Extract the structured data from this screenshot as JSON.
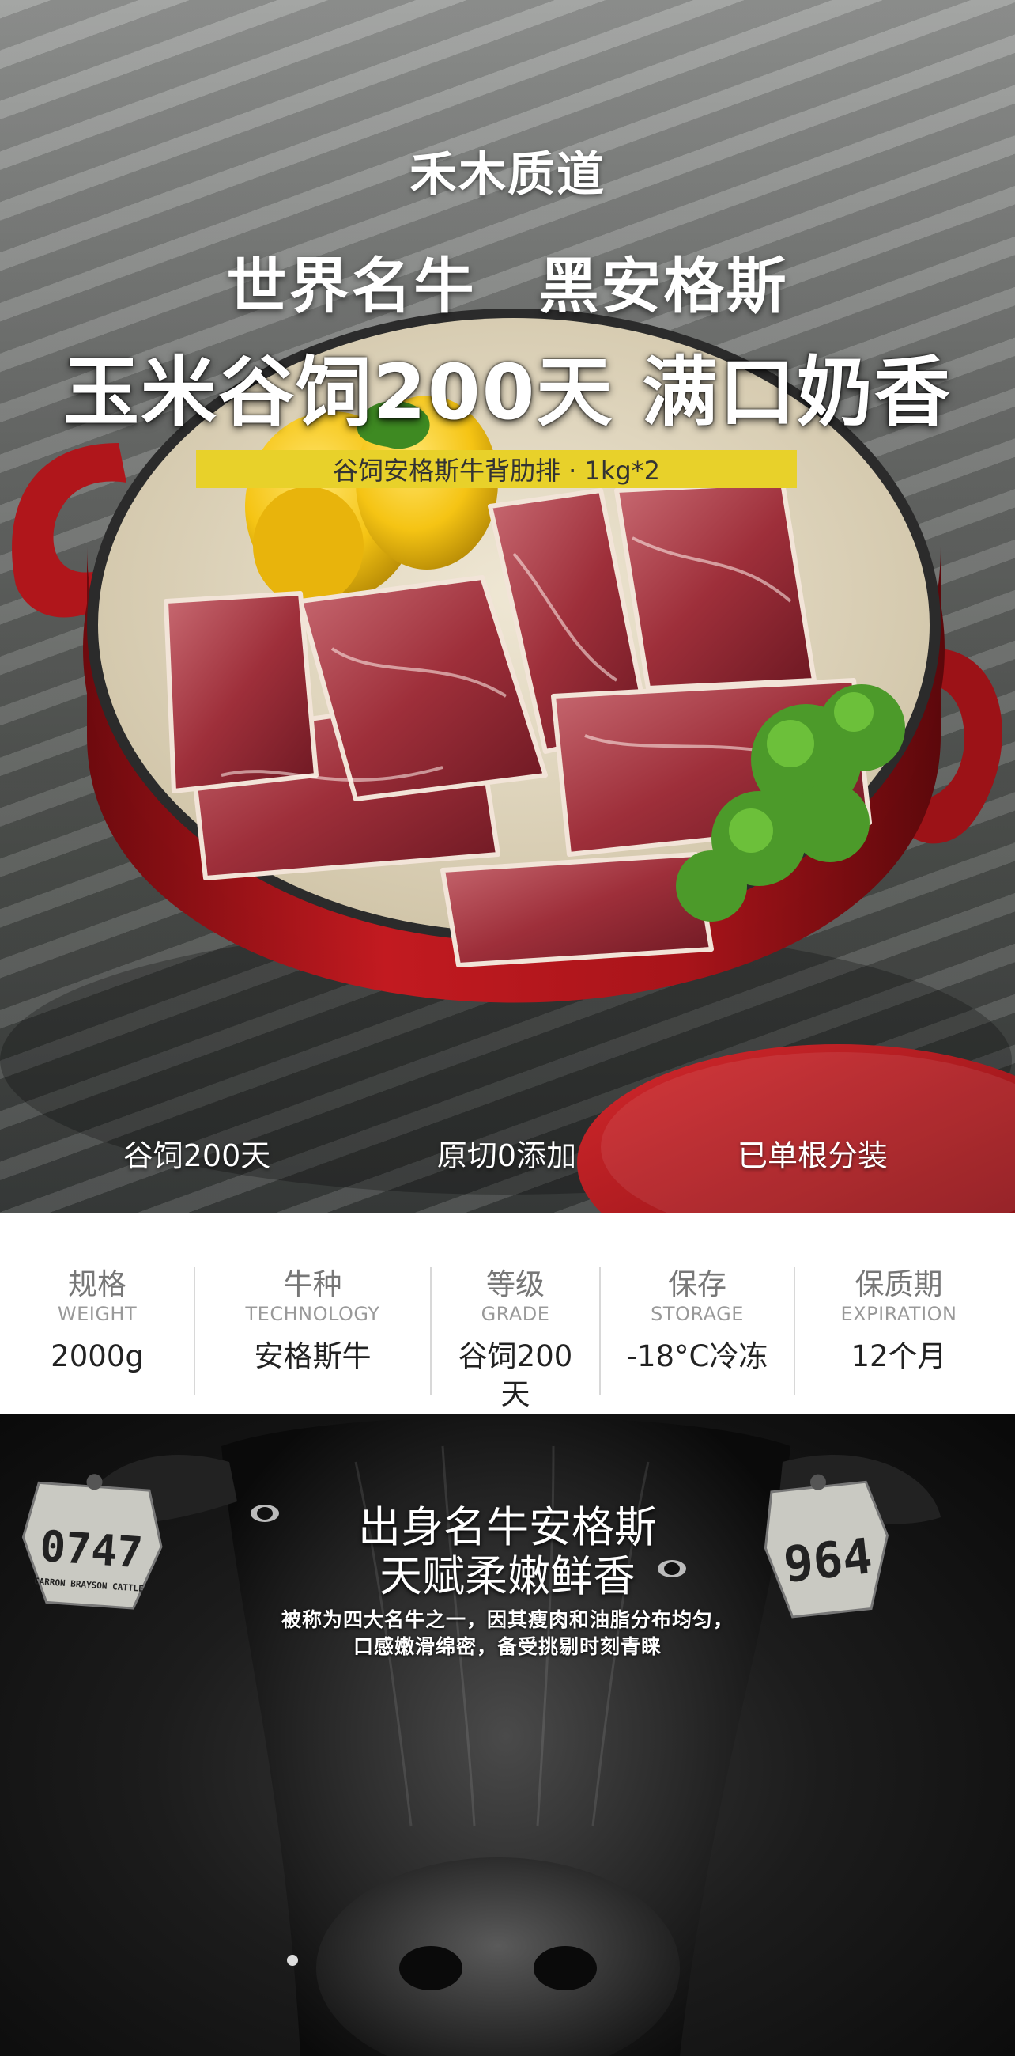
{
  "hero": {
    "brand": "禾木质道",
    "headline_1": "世界名牛　黑安格斯",
    "headline_2": "玉米谷饲200天 满口奶香",
    "product_banner": "谷饲安格斯牛背肋排 · 1kg*2",
    "features": [
      "谷饲200天",
      "原切0添加",
      "已单根分装"
    ]
  },
  "specs": [
    {
      "title": "规格",
      "en": "WEIGHT",
      "value": "2000g"
    },
    {
      "title": "牛种",
      "en": "TECHNOLOGY",
      "value": "安格斯牛"
    },
    {
      "title": "等级",
      "en": "GRADE",
      "value": "谷饲200天"
    },
    {
      "title": "保存",
      "en": "STORAGE",
      "value": "-18°C冷冻"
    },
    {
      "title": "保质期",
      "en": "EXPIRATION",
      "value": "12个月"
    }
  ],
  "cow_section": {
    "title_1": "出身名牛安格斯",
    "title_2": "天赋柔嫩鲜香",
    "desc_1": "被称为四大名牛之一，因其瘦肉和油脂分布均匀，",
    "desc_2": "口感嫩滑绵密，备受挑剔时刻青睐",
    "ear_tag_left": "0747",
    "ear_tag_left_small": "CARRON BRAYSON CATTLE",
    "ear_tag_right": "964"
  },
  "colors": {
    "pot_red": "#b3161c",
    "banner_yellow": "#e8d12a",
    "spec_bg": "#ffffff"
  },
  "icons": [
    "yellow-pepper",
    "beef-ribs",
    "kale",
    "cast-iron-pot",
    "pot-lid",
    "ear-tag"
  ]
}
